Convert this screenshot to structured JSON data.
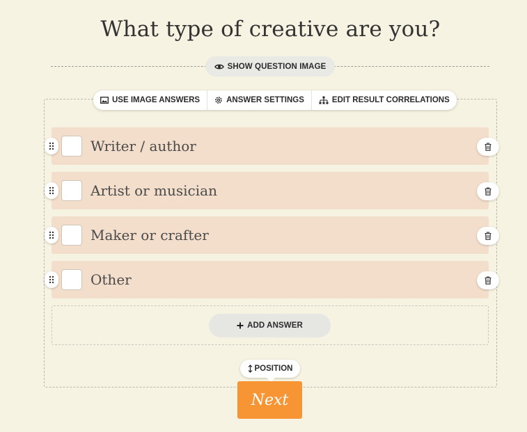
{
  "question": {
    "title": "What type of creative are you?"
  },
  "show_image_button": {
    "label": "SHOW QUESTION IMAGE",
    "icon": "eye-icon"
  },
  "toolbar": {
    "items": [
      {
        "label": "USE IMAGE ANSWERS",
        "icon": "image-icon"
      },
      {
        "label": "ANSWER SETTINGS",
        "icon": "gear-icon"
      },
      {
        "label": "EDIT RESULT CORRELATIONS",
        "icon": "sitemap-icon"
      }
    ]
  },
  "answers": [
    {
      "label": "Writer / author"
    },
    {
      "label": "Artist or musician"
    },
    {
      "label": "Maker or crafter"
    },
    {
      "label": "Other"
    }
  ],
  "add_answer": {
    "label": "ADD ANSWER",
    "icon": "plus-icon"
  },
  "position": {
    "label": "POSITION",
    "icon": "vertical-arrows-icon"
  },
  "next": {
    "label": "Next"
  },
  "colors": {
    "background": "#f7f3e2",
    "answer_row": "#f3decb",
    "next_button": "#f79535"
  }
}
